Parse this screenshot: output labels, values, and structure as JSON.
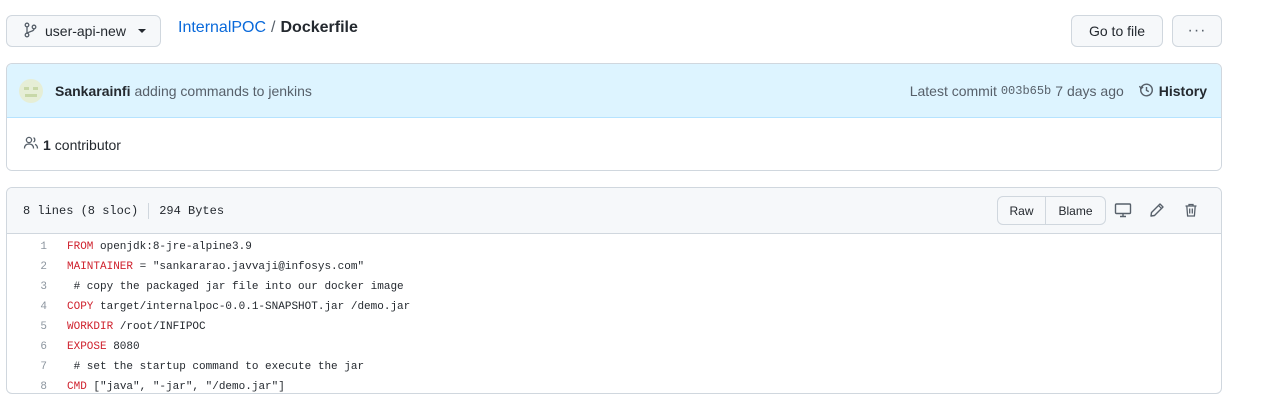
{
  "branch": {
    "name": "user-api-new"
  },
  "breadcrumb": {
    "repo": "InternalPOC",
    "separator": "/",
    "file": "Dockerfile"
  },
  "actions": {
    "go_to_file": "Go to file",
    "more": "···"
  },
  "commit": {
    "author": "Sankarainfi",
    "message": "adding commands to jenkins",
    "latest_label": "Latest commit",
    "sha": "003b65b",
    "age": "7 days ago",
    "history_label": "History"
  },
  "contributors": {
    "count": "1",
    "label": "contributor"
  },
  "file": {
    "lines_info": "8 lines (8 sloc)",
    "size": "294 Bytes",
    "raw_label": "Raw",
    "blame_label": "Blame"
  },
  "code": {
    "lines": [
      {
        "num": "1",
        "kw": "FROM",
        "rest": " openjdk:8-jre-alpine3.9"
      },
      {
        "num": "2",
        "kw": "MAINTAINER",
        "rest": " = \"sankararao.javvaji@infosys.com\""
      },
      {
        "num": "3",
        "kw": "",
        "rest": " # copy the packaged jar file into our docker image"
      },
      {
        "num": "4",
        "kw": "COPY",
        "rest": " target/internalpoc-0.0.1-SNAPSHOT.jar /demo.jar"
      },
      {
        "num": "5",
        "kw": "WORKDIR",
        "rest": " /root/INFIPOC"
      },
      {
        "num": "6",
        "kw": "EXPOSE",
        "rest": " 8080"
      },
      {
        "num": "7",
        "kw": "",
        "rest": " # set the startup command to execute the jar"
      },
      {
        "num": "8",
        "kw": "CMD",
        "rest": " [\"java\", \"-jar\", \"/demo.jar\"]"
      }
    ]
  },
  "colors": {
    "link": "#0969da",
    "keyword": "#cf222e",
    "commit_bg": "#ddf4ff"
  },
  "icons": [
    "git-branch-icon",
    "kebab-horizontal-icon",
    "history-icon",
    "people-icon",
    "desktop-icon",
    "pencil-icon",
    "trash-icon"
  ]
}
